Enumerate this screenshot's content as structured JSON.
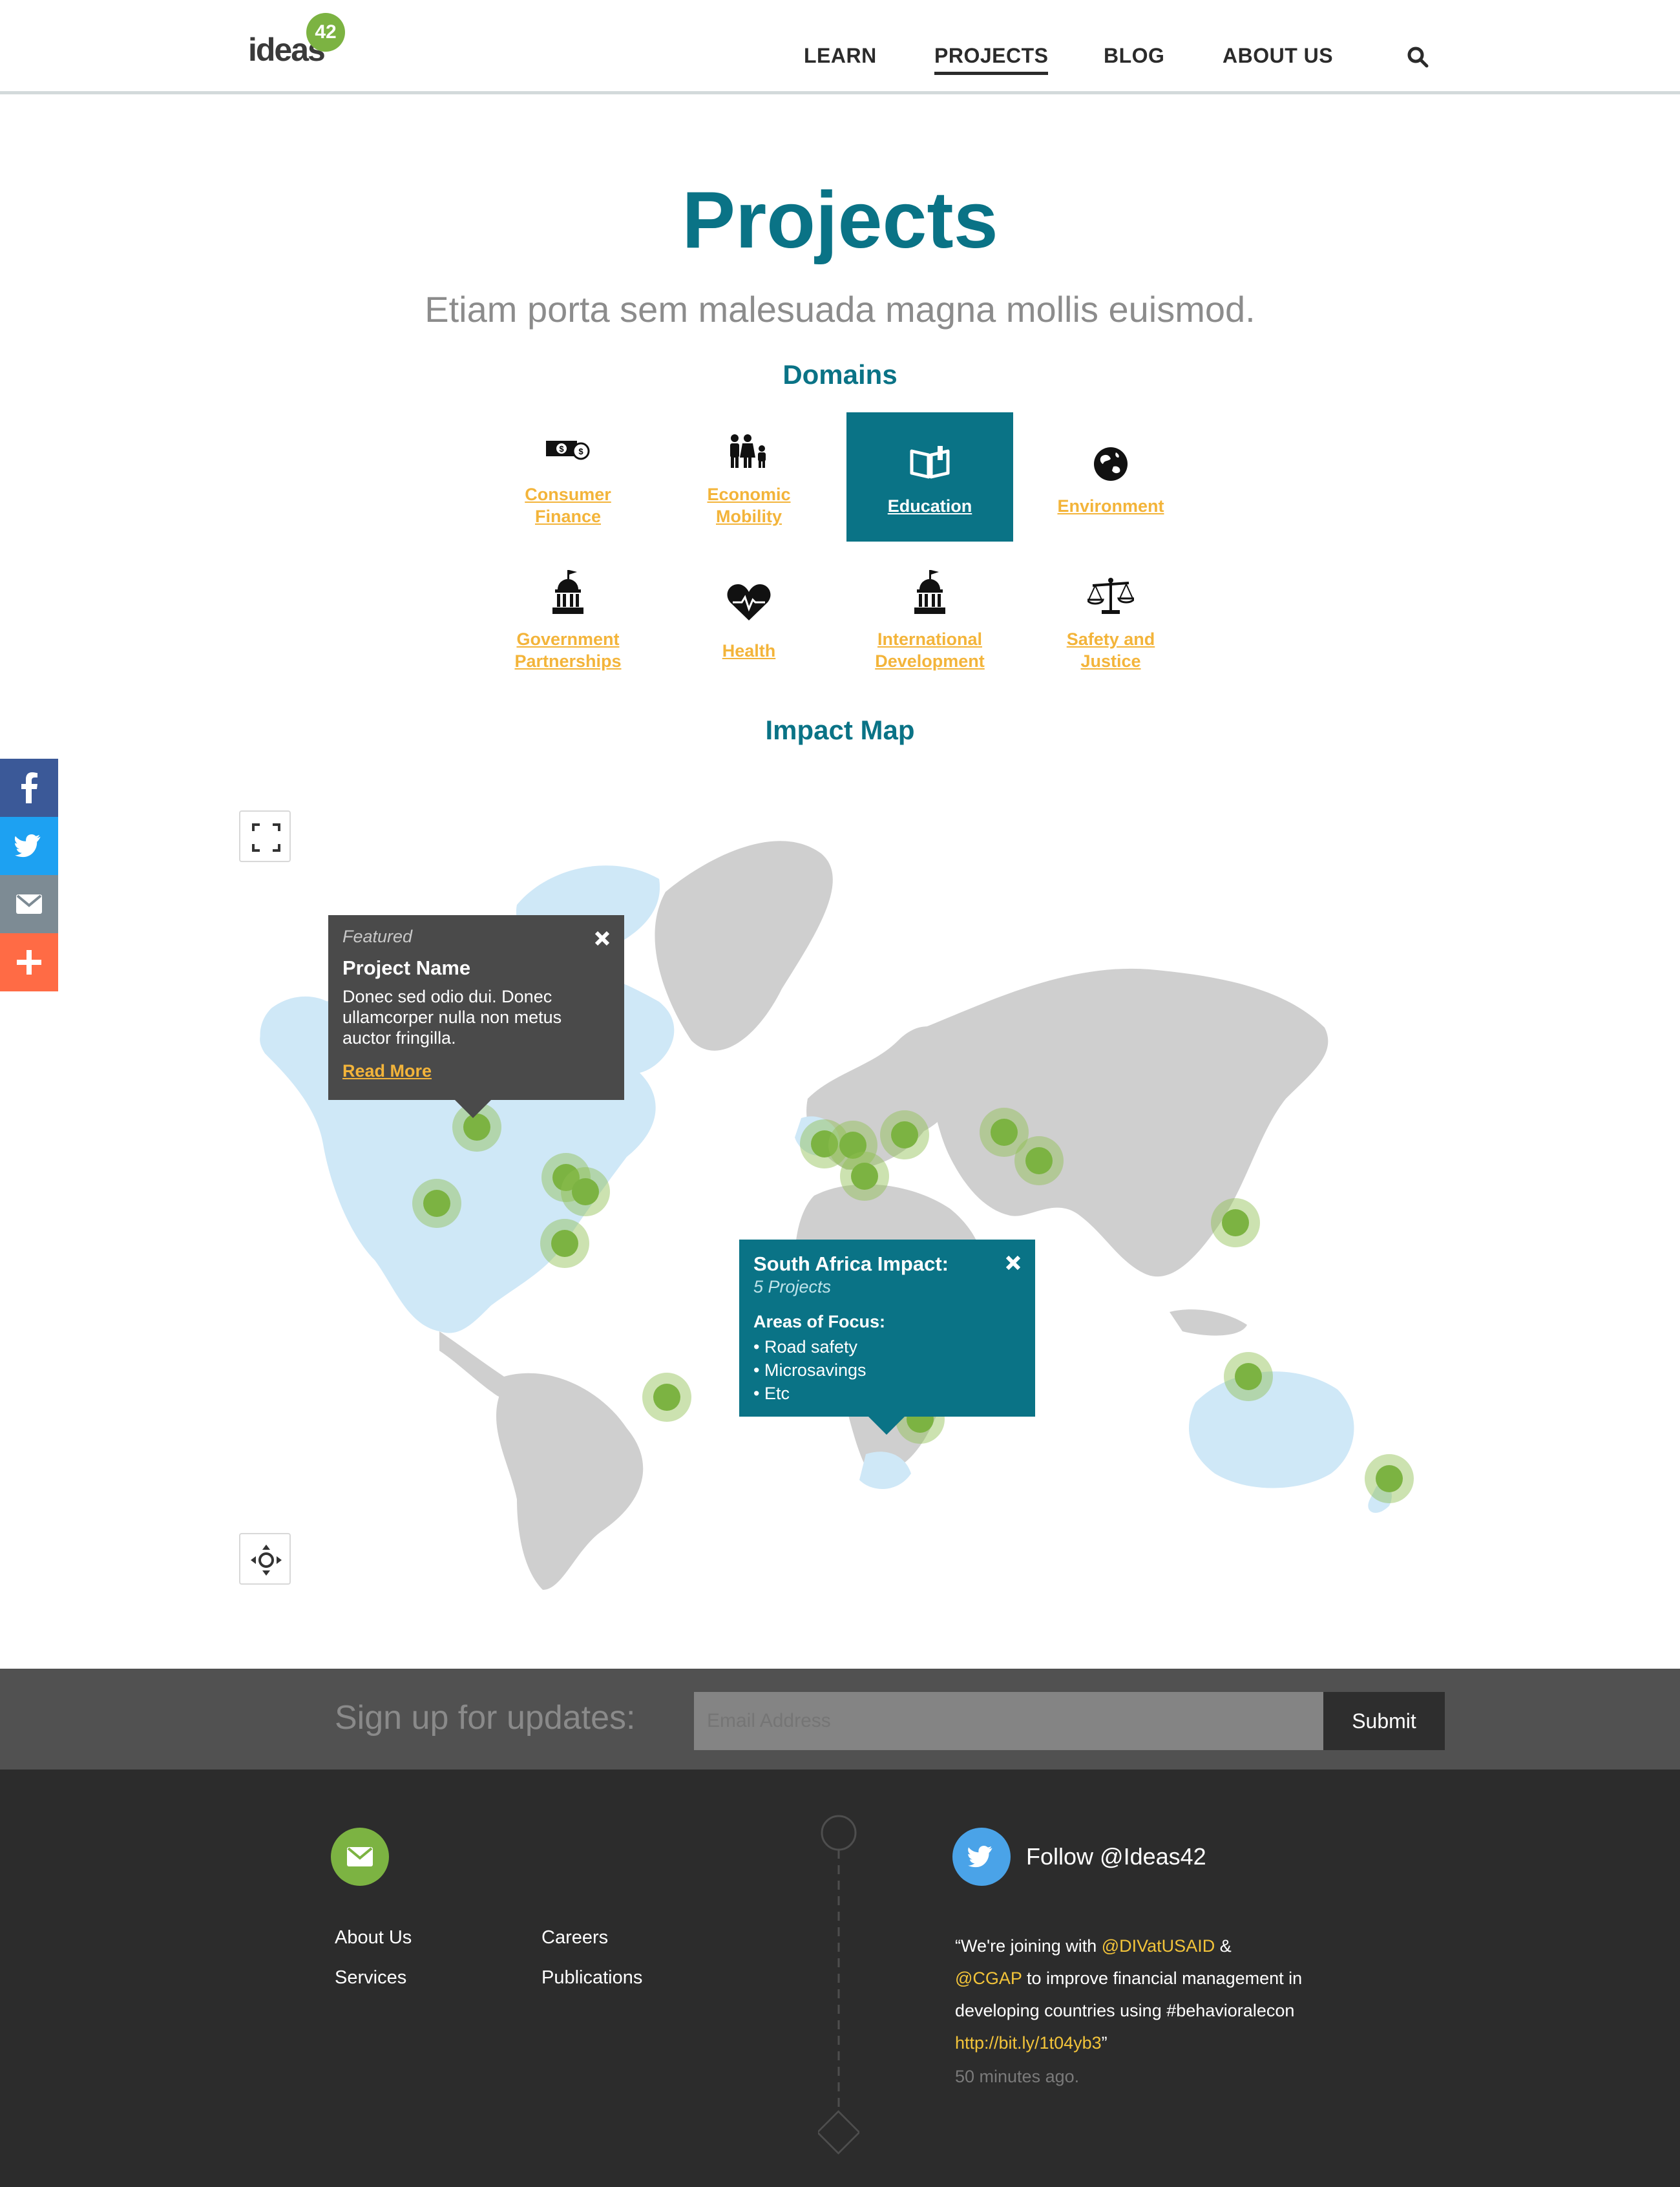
{
  "header": {
    "logo_text": "ideas",
    "logo_badge": "42",
    "nav": [
      "LEARN",
      "PROJECTS",
      "BLOG",
      "ABOUT US"
    ],
    "active_nav": "PROJECTS"
  },
  "hero": {
    "title": "Projects",
    "subtitle": "Etiam porta sem malesuada magna mollis euismod."
  },
  "domains": {
    "heading": "Domains",
    "items": [
      {
        "label_1": "Consumer",
        "label_2": "Finance",
        "icon": "money-icon"
      },
      {
        "label_1": "Economic",
        "label_2": "Mobility",
        "icon": "family-icon"
      },
      {
        "label_1": "Education",
        "label_2": "",
        "icon": "book-icon",
        "active": true
      },
      {
        "label_1": "Environment",
        "label_2": "",
        "icon": "globe-icon"
      },
      {
        "label_1": "Government",
        "label_2": "Partnerships",
        "icon": "capitol-icon"
      },
      {
        "label_1": "Health",
        "label_2": "",
        "icon": "heart-pulse-icon"
      },
      {
        "label_1": "International",
        "label_2": "Development",
        "icon": "capitol-icon"
      },
      {
        "label_1": "Safety and",
        "label_2": "Justice",
        "icon": "scales-icon"
      }
    ]
  },
  "impact_map": {
    "heading": "Impact Map",
    "featured_popup": {
      "tag": "Featured",
      "title": "Project Name",
      "body": "Donec sed odio dui. Donec ullamcorper nulla non metus auctor fringilla.",
      "link": "Read More"
    },
    "region_popup": {
      "title": "South Africa Impact:",
      "count": "5 Projects",
      "focus_heading": "Areas of Focus:",
      "focus_items": [
        "• Road safety",
        "• Microsavings",
        "• Etc"
      ]
    }
  },
  "social": [
    "facebook-icon",
    "twitter-icon",
    "email-icon",
    "plus-icon"
  ],
  "signup": {
    "label": "Sign up for updates:",
    "placeholder": "Email Address",
    "button": "Submit"
  },
  "footer": {
    "links": [
      "About Us",
      "Careers",
      "Services",
      "Publications"
    ],
    "twitter_handle": "Follow @Ideas42",
    "tweet": {
      "open_quote": "“We're joining with ",
      "mention_1": "@DIVatUSAID",
      "amp": " &",
      "mention_2": "@CGAP",
      "text_2": " to improve financial management in developing countries using #behavioralecon ",
      "link": "http://bit.ly/1t04yb3",
      "close_quote": "”",
      "time": "50 minutes ago."
    }
  },
  "colors": {
    "teal": "#0a7386",
    "green": "#7cb342",
    "gold": "#f3b43a",
    "footer_bg": "#2c2c2c"
  }
}
